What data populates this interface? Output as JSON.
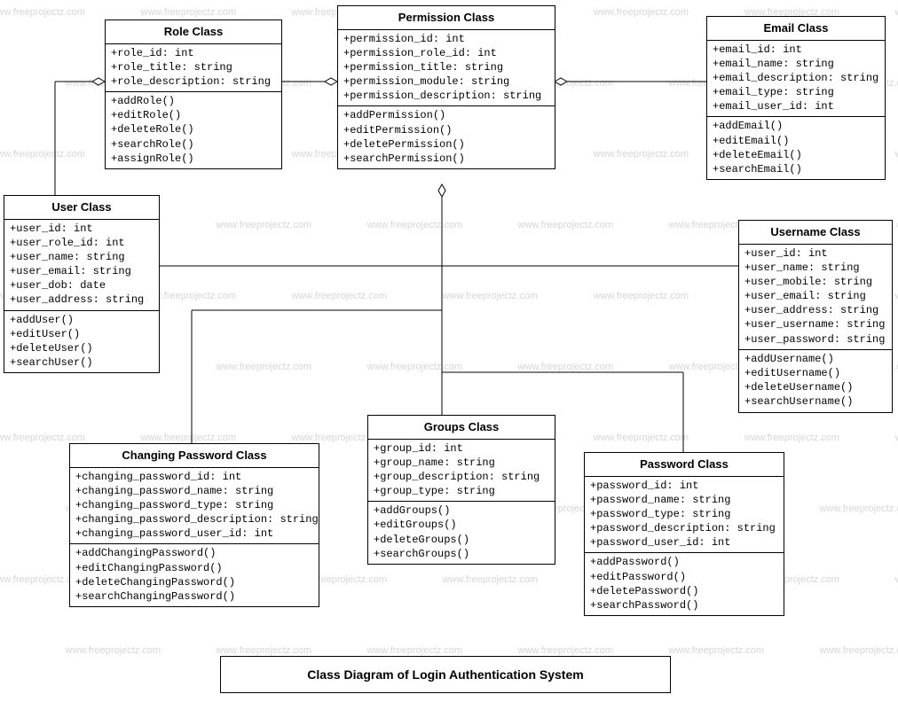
{
  "watermark": "www.freeprojectz.com",
  "caption": "Class Diagram of Login Authentication System",
  "classes": {
    "role": {
      "title": "Role Class",
      "attrs": [
        "+role_id: int",
        "+role_title: string",
        "+role_description: string"
      ],
      "ops": [
        "+addRole()",
        "+editRole()",
        "+deleteRole()",
        "+searchRole()",
        "+assignRole()"
      ]
    },
    "permission": {
      "title": "Permission Class",
      "attrs": [
        "+permission_id: int",
        "+permission_role_id: int",
        "+permission_title: string",
        "+permission_module: string",
        "+permission_description: string"
      ],
      "ops": [
        "+addPermission()",
        "+editPermission()",
        "+deletePermission()",
        "+searchPermission()"
      ]
    },
    "email": {
      "title": "Email Class",
      "attrs": [
        "+email_id: int",
        "+email_name: string",
        "+email_description: string",
        "+email_type: string",
        "+email_user_id: int"
      ],
      "ops": [
        "+addEmail()",
        "+editEmail()",
        "+deleteEmail()",
        "+searchEmail()"
      ]
    },
    "user": {
      "title": "User Class",
      "attrs": [
        "+user_id: int",
        "+user_role_id: int",
        "+user_name: string",
        "+user_email: string",
        "+user_dob: date",
        "+user_address: string"
      ],
      "ops": [
        "+addUser()",
        "+editUser()",
        "+deleteUser()",
        "+searchUser()"
      ]
    },
    "username": {
      "title": "Username Class",
      "attrs": [
        "+user_id: int",
        "+user_name: string",
        "+user_mobile: string",
        "+user_email: string",
        "+user_address: string",
        "+user_username: string",
        "+user_password: string"
      ],
      "ops": [
        "+addUsername()",
        "+editUsername()",
        "+deleteUsername()",
        "+searchUsername()"
      ]
    },
    "changing": {
      "title": "Changing Password Class",
      "attrs": [
        "+changing_password_id: int",
        "+changing_password_name: string",
        "+changing_password_type: string",
        "+changing_password_description: string",
        "+changing_password_user_id: int"
      ],
      "ops": [
        "+addChangingPassword()",
        "+editChangingPassword()",
        "+deleteChangingPassword()",
        "+searchChangingPassword()"
      ]
    },
    "groups": {
      "title": "Groups Class",
      "attrs": [
        "+group_id: int",
        "+group_name: string",
        "+group_description: string",
        "+group_type: string"
      ],
      "ops": [
        "+addGroups()",
        "+editGroups()",
        "+deleteGroups()",
        "+searchGroups()"
      ]
    },
    "password": {
      "title": "Password Class",
      "attrs": [
        "+password_id: int",
        "+password_name: string",
        "+password_type: string",
        "+password_description: string",
        "+password_user_id: int"
      ],
      "ops": [
        "+addPassword()",
        "+editPassword()",
        "+deletePassword()",
        "+searchPassword()"
      ]
    }
  }
}
